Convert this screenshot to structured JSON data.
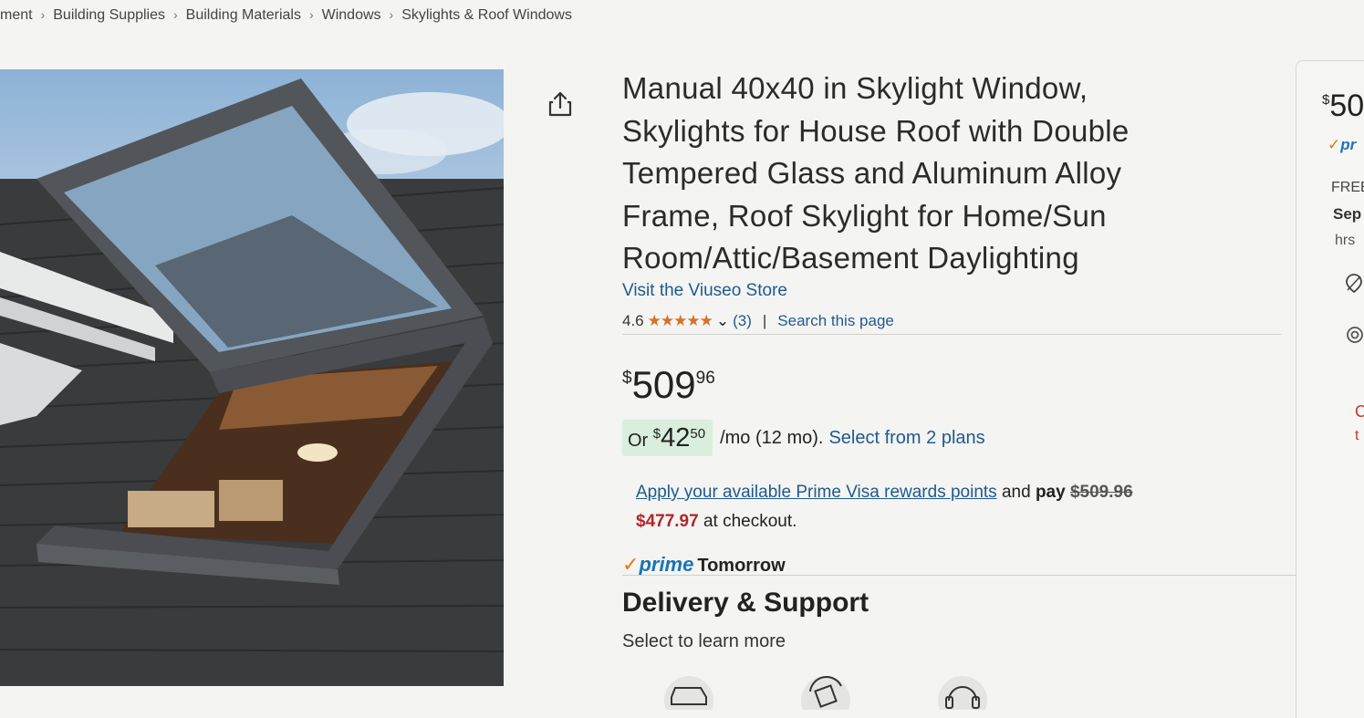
{
  "breadcrumb": {
    "items": [
      "ment",
      "Building Supplies",
      "Building Materials",
      "Windows",
      "Skylights & Roof Windows"
    ],
    "separator": "›"
  },
  "product": {
    "title_lines": [
      "Manual 40x40 in Skylight Window,",
      "Skylights for House Roof with Double",
      "Tempered Glass and Aluminum Alloy",
      "Frame, Roof Skylight for Home/Sun",
      "Room/Attic/Basement Daylighting"
    ],
    "store_link": "Visit the Viuseo Store",
    "rating": "4.6",
    "rating_stars": 4.6,
    "stars_glyphs": "★★★★★",
    "rating_count": "(3)",
    "pipe": "|",
    "search_link": "Search this page",
    "price": {
      "symbol": "$",
      "whole": "509",
      "cents": "96"
    },
    "monthly": {
      "prefix": "Or",
      "symbol": "$",
      "whole": "42",
      "cents": "50",
      "term": "/mo (12 mo).",
      "plans_link": "Select from 2 plans"
    },
    "rewards": {
      "link": "Apply your available Prime Visa rewards points",
      "and": "and",
      "pay": "pay",
      "original_price": "$509.96",
      "new_price": "$477.97",
      "suffix": "at checkout."
    },
    "prime": {
      "check": "✓",
      "word": "prime",
      "delivery_day": "Tomorrow"
    },
    "delivery": {
      "title": "Delivery & Support",
      "subtitle": "Select to learn more",
      "icons": [
        "car-icon",
        "package-return-icon",
        "headset-icon"
      ]
    }
  },
  "buybox": {
    "price_symbol": "$",
    "price_partial": "50",
    "prime_check": "✓",
    "prime_partial": "pr",
    "free_partial": "FREE",
    "date_partial": "Sep",
    "hrs_partial": "hrs",
    "c_partial": "C",
    "t_partial": "t"
  },
  "colors": {
    "link": "#1f5a8f",
    "star": "#d4722a",
    "prime_blue": "#1a73b5",
    "prime_check": "#e47911",
    "sale_red": "#b3242b",
    "monthly_badge_bg": "#d9eedc"
  }
}
